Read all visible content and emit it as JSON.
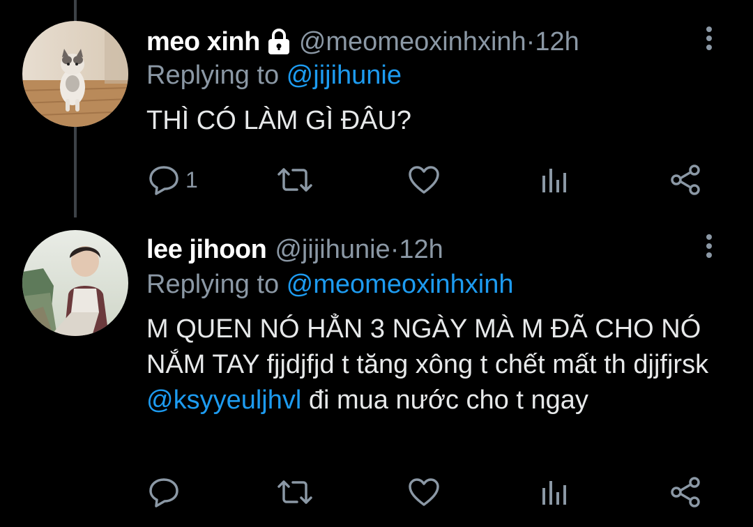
{
  "tweets": [
    {
      "display_name": "meo xinh",
      "protected": true,
      "handle": "@meomeoxinhxinh",
      "separator": " · ",
      "time": "12h",
      "replying_prefix": "Replying to ",
      "replying_to": "@jijihunie",
      "text": "THÌ CÓ LÀM GÌ ĐÂU?",
      "reply_count": "1",
      "avatar_icon": "cat-photo-avatar"
    },
    {
      "display_name": "lee jihoon",
      "protected": false,
      "handle": "@jijihunie",
      "separator": " · ",
      "time": "12h",
      "replying_prefix": "Replying to ",
      "replying_to": "@meomeoxinhxinh",
      "text_before_mention": "M QUEN NÓ HẲN 3 NGÀY MÀ M ĐÃ CHO NÓ NẮM TAY fjjdjfjd t tăng xông t chết mất th djjfjrsk ",
      "text_mention": "@ksyyeuljhvl",
      "text_after_mention": " đi mua nước cho t ngay",
      "reply_count": "",
      "avatar_icon": "person-photo-avatar"
    }
  ],
  "icons": {
    "reply": "reply-bubble-icon",
    "retweet": "retweet-icon",
    "like": "heart-icon",
    "stats": "bar-chart-icon",
    "share": "share-icon",
    "more": "vertical-dots-icon",
    "lock": "lock-icon"
  },
  "colors": {
    "background": "#000000",
    "name": "#ffffff",
    "muted": "#8b98a5",
    "link": "#1d9bf0",
    "text": "#e7e9ea",
    "thread_line": "#3d4247"
  }
}
